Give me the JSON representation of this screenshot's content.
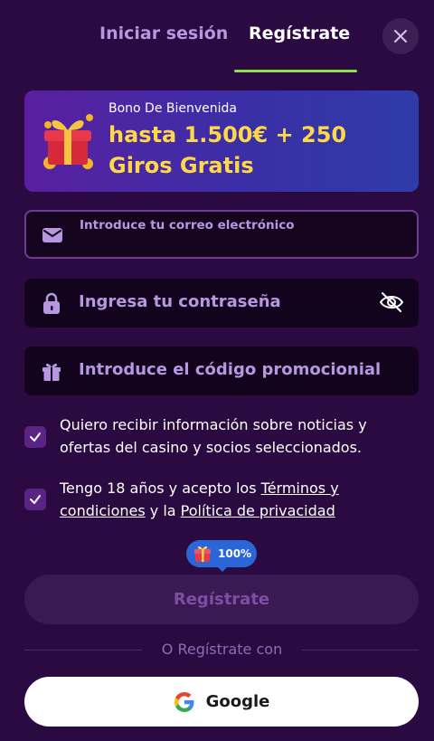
{
  "tabs": {
    "login_label": "Iniciar sesión",
    "register_label": "Regístrate",
    "active": "register"
  },
  "bonus": {
    "subtitle": "Bono De Bienvenida",
    "title": "hasta 1.500€ + 250 Giros Gratis"
  },
  "form": {
    "email_placeholder": "Introduce tu correo electrónico",
    "password_placeholder": "Ingresa tu contraseña",
    "promo_placeholder": "Introduce el código promocionial"
  },
  "checkboxes": {
    "marketing": {
      "text": "Quiero recibir información sobre noticias y ofertas del casino y socios seleccionados.",
      "checked": true
    },
    "terms": {
      "prefix": "Tengo 18 años y acepto los ",
      "terms_link": "Términos y condiciones",
      "middle": " y la ",
      "privacy_link": "Política de privacidad",
      "checked": true
    }
  },
  "progress_badge": "100%",
  "submit_label": "Regístrate",
  "divider_text": "O Regístrate con",
  "google_label": "Google",
  "colors": {
    "background": "#2a0a40",
    "accent_green": "#8ee04a",
    "bonus_yellow": "#ffd84a",
    "muted_purple": "#b697e0",
    "badge_blue": "#2b66d8"
  },
  "icons": {
    "close": "close-icon",
    "email": "envelope-icon",
    "password": "lock-icon",
    "visibility": "eye-off-icon",
    "promo": "gift-icon",
    "check": "check-icon",
    "google": "google-icon"
  }
}
